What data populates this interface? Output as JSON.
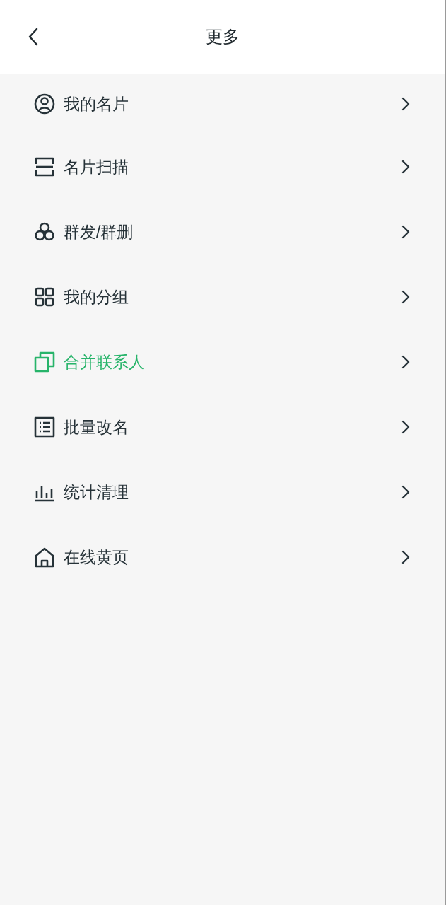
{
  "header": {
    "title": "更多"
  },
  "menu": [
    {
      "label": "我的名片",
      "selected": false
    },
    {
      "label": "名片扫描",
      "selected": false
    },
    {
      "label": "群发/群删",
      "selected": false
    },
    {
      "label": "我的分组",
      "selected": false
    },
    {
      "label": "合并联系人",
      "selected": true
    },
    {
      "label": "批量改名",
      "selected": false
    },
    {
      "label": "统计清理",
      "selected": false
    },
    {
      "label": "在线黄页",
      "selected": false
    }
  ]
}
